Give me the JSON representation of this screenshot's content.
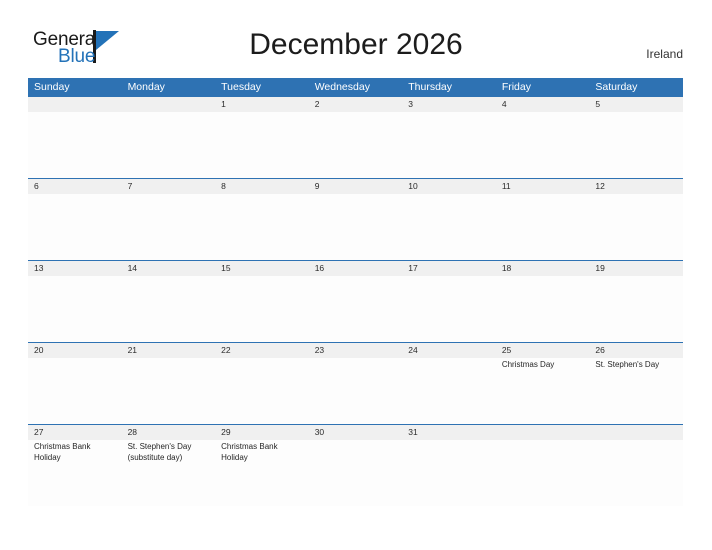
{
  "brand": {
    "name_part1": "General",
    "name_part2": "Blue",
    "flag_icon": "flag-triangle-icon"
  },
  "header": {
    "title": "December 2026",
    "region": "Ireland"
  },
  "colors": {
    "header_blue": "#2e72b3",
    "number_strip_gray": "#f0f0f0",
    "brand_blue": "#2372b8",
    "text_dark": "#1c1c1c"
  },
  "calendar": {
    "weekdays": [
      "Sunday",
      "Monday",
      "Tuesday",
      "Wednesday",
      "Thursday",
      "Friday",
      "Saturday"
    ],
    "weeks": [
      {
        "days": [
          {
            "num": "",
            "events": []
          },
          {
            "num": "",
            "events": []
          },
          {
            "num": "1",
            "events": []
          },
          {
            "num": "2",
            "events": []
          },
          {
            "num": "3",
            "events": []
          },
          {
            "num": "4",
            "events": []
          },
          {
            "num": "5",
            "events": []
          }
        ]
      },
      {
        "days": [
          {
            "num": "6",
            "events": []
          },
          {
            "num": "7",
            "events": []
          },
          {
            "num": "8",
            "events": []
          },
          {
            "num": "9",
            "events": []
          },
          {
            "num": "10",
            "events": []
          },
          {
            "num": "11",
            "events": []
          },
          {
            "num": "12",
            "events": []
          }
        ]
      },
      {
        "days": [
          {
            "num": "13",
            "events": []
          },
          {
            "num": "14",
            "events": []
          },
          {
            "num": "15",
            "events": []
          },
          {
            "num": "16",
            "events": []
          },
          {
            "num": "17",
            "events": []
          },
          {
            "num": "18",
            "events": []
          },
          {
            "num": "19",
            "events": []
          }
        ]
      },
      {
        "days": [
          {
            "num": "20",
            "events": []
          },
          {
            "num": "21",
            "events": []
          },
          {
            "num": "22",
            "events": []
          },
          {
            "num": "23",
            "events": []
          },
          {
            "num": "24",
            "events": []
          },
          {
            "num": "25",
            "events": [
              "Christmas Day"
            ]
          },
          {
            "num": "26",
            "events": [
              "St. Stephen's Day"
            ]
          }
        ]
      },
      {
        "days": [
          {
            "num": "27",
            "events": [
              "Christmas Bank Holiday"
            ]
          },
          {
            "num": "28",
            "events": [
              "St. Stephen's Day (substitute day)"
            ]
          },
          {
            "num": "29",
            "events": [
              "Christmas Bank Holiday"
            ]
          },
          {
            "num": "30",
            "events": []
          },
          {
            "num": "31",
            "events": []
          },
          {
            "num": "",
            "events": []
          },
          {
            "num": "",
            "events": []
          }
        ]
      }
    ]
  }
}
